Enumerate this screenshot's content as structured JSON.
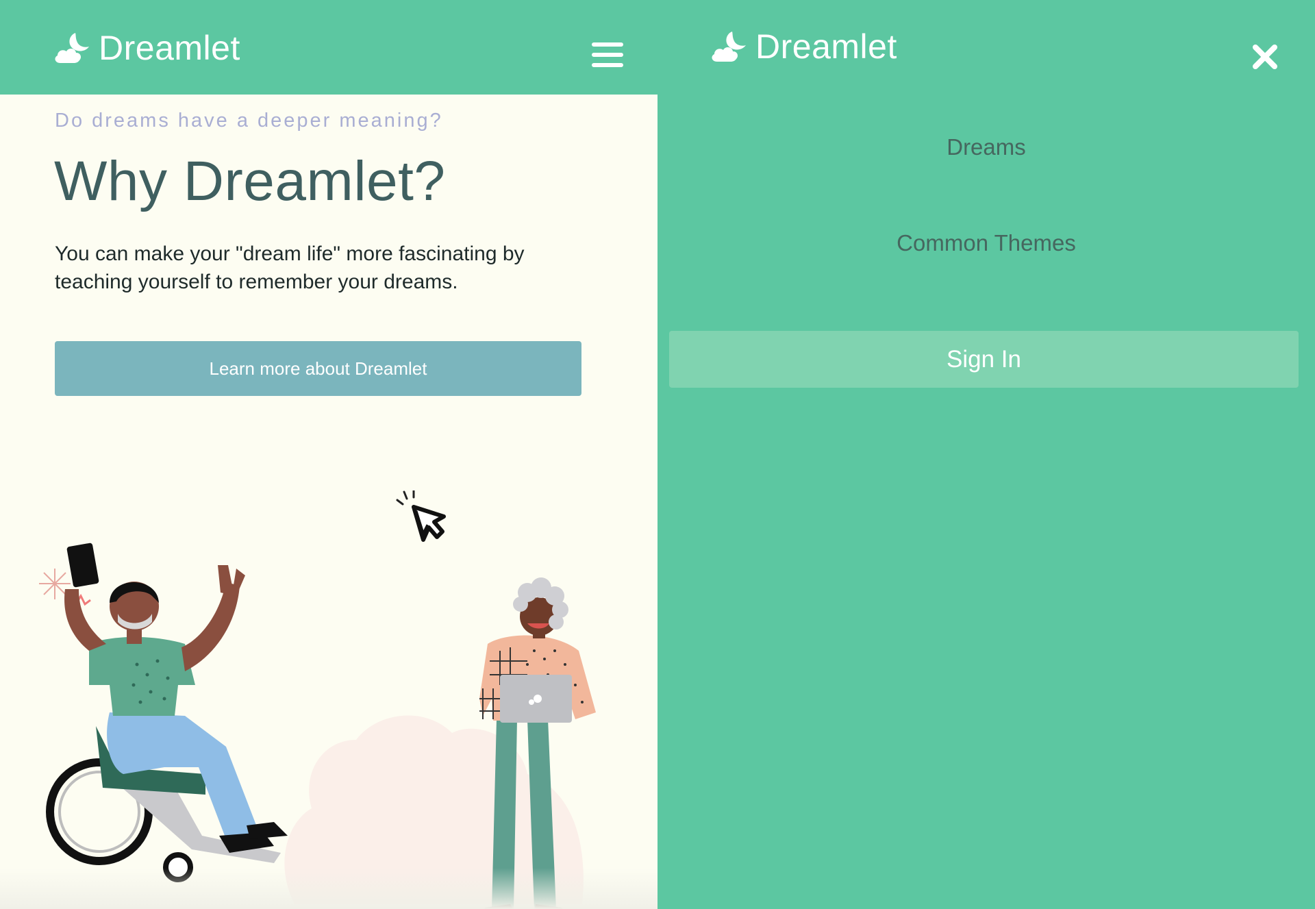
{
  "colors": {
    "brand_green": "#5cc7a1",
    "page_background": "#fdfdf2",
    "button_blue": "#7bb5bd",
    "signin_green": "#80d3b0",
    "headline": "#3f5f60",
    "eyebrow": "#a9aed3"
  },
  "left": {
    "header": {
      "brand": "Dreamlet",
      "logo_icon": "moon-cloud-icon",
      "menu_icon": "hamburger-menu-icon"
    },
    "eyebrow": "Do dreams have a deeper meaning?",
    "headline": "Why Dreamlet?",
    "body": "You can make your \"dream life\" more fascinating by teaching yourself to remember your dreams.",
    "cta_label": "Learn more about Dreamlet"
  },
  "right": {
    "header": {
      "brand": "Dreamlet",
      "logo_icon": "moon-cloud-icon",
      "close_icon": "close-icon"
    },
    "nav": [
      {
        "label": "Dreams"
      },
      {
        "label": "Common Themes"
      }
    ],
    "signin_label": "Sign In"
  }
}
